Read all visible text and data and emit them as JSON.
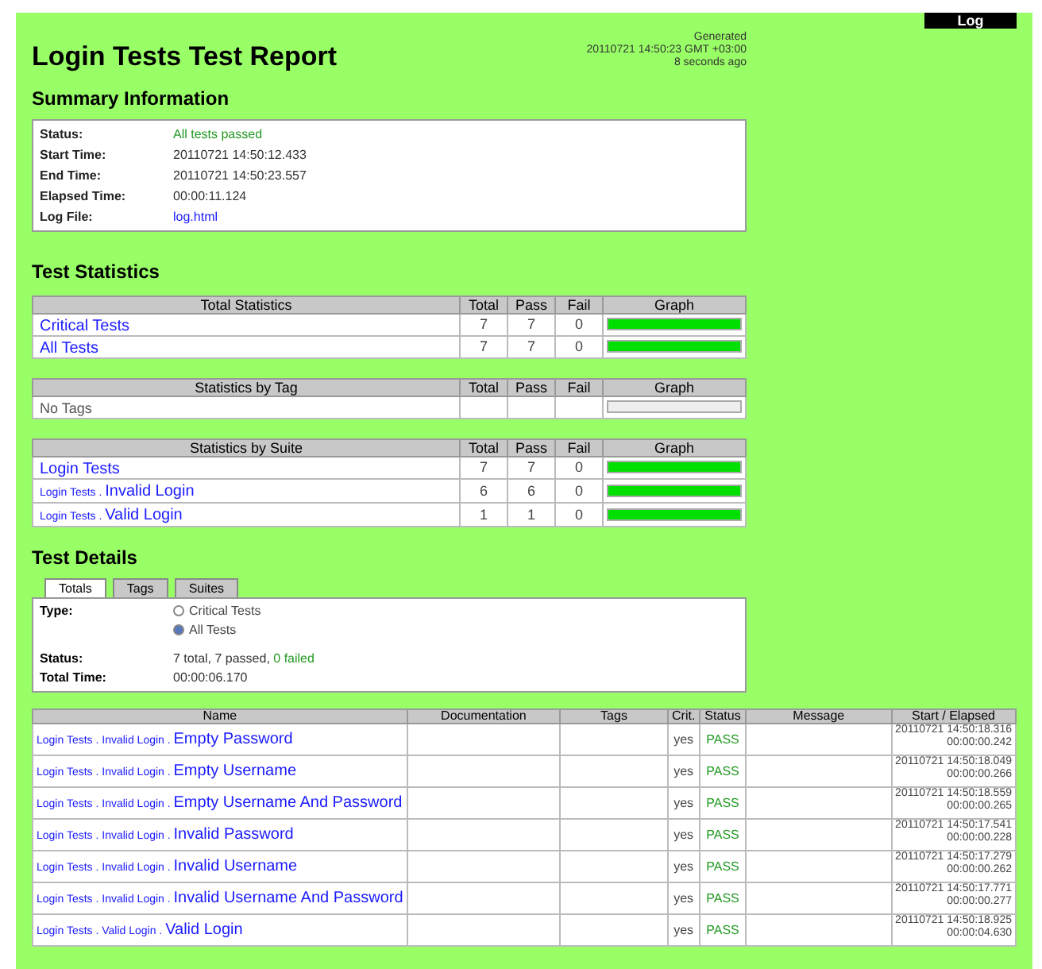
{
  "log_button": "Log",
  "header": {
    "title": "Login Tests Test Report",
    "generated": [
      "Generated",
      "20110721 14:50:23 GMT +03:00",
      "8 seconds ago"
    ]
  },
  "summary": {
    "title": "Summary Information",
    "rows": [
      {
        "label": "Status:",
        "value": "All tests passed",
        "kind": "status"
      },
      {
        "label": "Start Time:",
        "value": "20110721 14:50:12.433",
        "kind": "text"
      },
      {
        "label": "End Time:",
        "value": "20110721 14:50:23.557",
        "kind": "text"
      },
      {
        "label": "Elapsed Time:",
        "value": "00:00:11.124",
        "kind": "text"
      },
      {
        "label": "Log File:",
        "value": "log.html",
        "kind": "link"
      }
    ]
  },
  "statistics": {
    "title": "Test Statistics",
    "tables": [
      {
        "columns": [
          "Total Statistics",
          "Total",
          "Pass",
          "Fail",
          "Graph"
        ],
        "rows": [
          {
            "prefix": "",
            "name": "Critical Tests",
            "total": "7",
            "pass": "7",
            "fail": "0",
            "level": 1
          },
          {
            "prefix": "",
            "name": "All Tests",
            "total": "7",
            "pass": "7",
            "fail": "0",
            "level": 1
          }
        ]
      },
      {
        "columns": [
          "Statistics by Tag",
          "Total",
          "Pass",
          "Fail",
          "Graph"
        ],
        "rows": [
          {
            "prefix": "",
            "name": "No Tags",
            "total": "",
            "pass": "",
            "fail": ""
          }
        ]
      },
      {
        "columns": [
          "Statistics by Suite",
          "Total",
          "Pass",
          "Fail",
          "Graph"
        ],
        "rows": [
          {
            "prefix": "",
            "name": "Login Tests",
            "total": "7",
            "pass": "7",
            "fail": "0",
            "level": 1
          },
          {
            "prefix": "Login Tests . ",
            "name": "Invalid Login",
            "total": "6",
            "pass": "6",
            "fail": "0",
            "level": 1
          },
          {
            "prefix": "Login Tests . ",
            "name": "Valid Login",
            "total": "1",
            "pass": "1",
            "fail": "0",
            "level": 1
          }
        ]
      }
    ]
  },
  "details": {
    "title": "Test Details",
    "tabs": [
      {
        "label": "Totals",
        "selected": true
      },
      {
        "label": "Tags",
        "selected": false
      },
      {
        "label": "Suites",
        "selected": false
      }
    ],
    "type_label": "Type:",
    "types": [
      {
        "label": "Critical Tests",
        "selected": false
      },
      {
        "label": "All Tests",
        "selected": true
      }
    ],
    "status_label": "Status:",
    "status_text": "7 total, 7 passed, ",
    "status_failed": "0 failed",
    "time_label": "Total Time:",
    "time_value": "00:00:06.170",
    "table": {
      "columns": [
        "Name",
        "Documentation",
        "Tags",
        "Crit.",
        "Status",
        "Message",
        "Start / Elapsed"
      ],
      "rows": [
        {
          "prefix": "Login Tests . Invalid Login . ",
          "name": "Empty Password",
          "crit": "yes",
          "status": "PASS",
          "start": "20110721 14:50:18.316",
          "elapsed": "00:00:00.242"
        },
        {
          "prefix": "Login Tests . Invalid Login . ",
          "name": "Empty Username",
          "crit": "yes",
          "status": "PASS",
          "start": "20110721 14:50:18.049",
          "elapsed": "00:00:00.266"
        },
        {
          "prefix": "Login Tests . Invalid Login . ",
          "name": "Empty Username And Password",
          "crit": "yes",
          "status": "PASS",
          "start": "20110721 14:50:18.559",
          "elapsed": "00:00:00.265"
        },
        {
          "prefix": "Login Tests . Invalid Login . ",
          "name": "Invalid Password",
          "crit": "yes",
          "status": "PASS",
          "start": "20110721 14:50:17.541",
          "elapsed": "00:00:00.228"
        },
        {
          "prefix": "Login Tests . Invalid Login . ",
          "name": "Invalid Username",
          "crit": "yes",
          "status": "PASS",
          "start": "20110721 14:50:17.279",
          "elapsed": "00:00:00.262"
        },
        {
          "prefix": "Login Tests . Invalid Login . ",
          "name": "Invalid Username And Password",
          "crit": "yes",
          "status": "PASS",
          "start": "20110721 14:50:17.771",
          "elapsed": "00:00:00.277"
        },
        {
          "prefix": "Login Tests . Valid Login . ",
          "name": "Valid Login",
          "crit": "yes",
          "status": "PASS",
          "start": "20110721 14:50:18.925",
          "elapsed": "00:00:04.630"
        }
      ]
    }
  }
}
